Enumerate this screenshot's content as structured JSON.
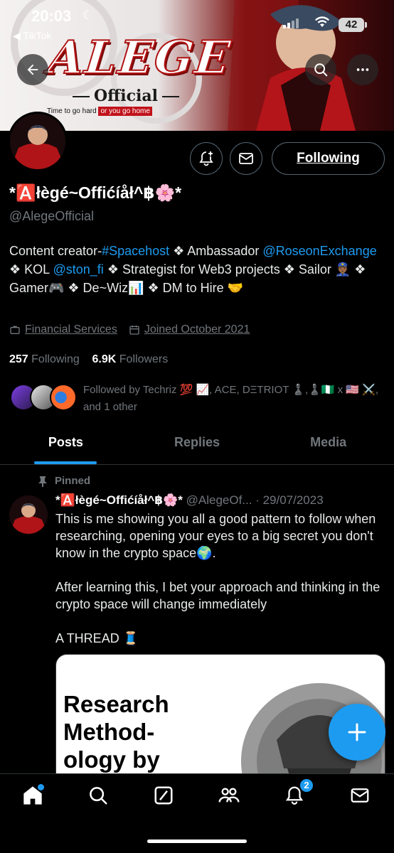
{
  "status_bar": {
    "time": "20:03",
    "back_app": "◀ TikTok",
    "battery": "42"
  },
  "banner": {
    "logo": "ALEGE",
    "subtitle": "Official",
    "tagline_a": "Time to go hard",
    "tagline_b": "or you go home"
  },
  "profile": {
    "display_name": "*🅰️łègé~Offićíåł^฿🌸*",
    "handle": "@AlegeOfficial",
    "follow_button": "Following",
    "bio": {
      "p1": "Content creator-",
      "link1": "#Spacehost",
      "p2": " ❖ Ambassador ",
      "link2": "@RoseonExchange",
      "p3": " ❖ KOL ",
      "link3": "@ston_fi",
      "p4": " ❖ Strategist for Web3 projects ❖ Sailor 👮🏾‍♂️ ❖ Gamer🎮 ❖ De~Wiz📊 ❖ DM to Hire 🤝"
    },
    "category": "Financial Services",
    "joined": "Joined October 2021",
    "following_count": "257",
    "following_label": "Following",
    "followers_count": "6.9K",
    "followers_label": "Followers",
    "followed_by": "Followed by Techriz 💯 📈, ACE, DΞTRIOT ♟️,♟️🇳🇬 x 🇺🇸 ⚔️, and 1 other"
  },
  "tabs": [
    "Posts",
    "Replies",
    "Media"
  ],
  "post": {
    "pinned_label": "Pinned",
    "author": "*🅰️łègé~Offićíåł^฿🌸*",
    "meta": " @AlegeOf... · 29/07/2023",
    "para1": "This is me showing you all a good pattern to follow when researching, opening your eyes to a big secret you don't know in the crypto space🌍.",
    "para2": "After learning this, I bet your approach and thinking in the crypto space will change immediately",
    "para3": "A THREAD 🧵",
    "media_title": "Research Method-ology by"
  },
  "nav": {
    "notifications_badge": "2"
  },
  "colors": {
    "accent": "#1d9bf0",
    "muted": "#71767b",
    "background": "#000000"
  }
}
